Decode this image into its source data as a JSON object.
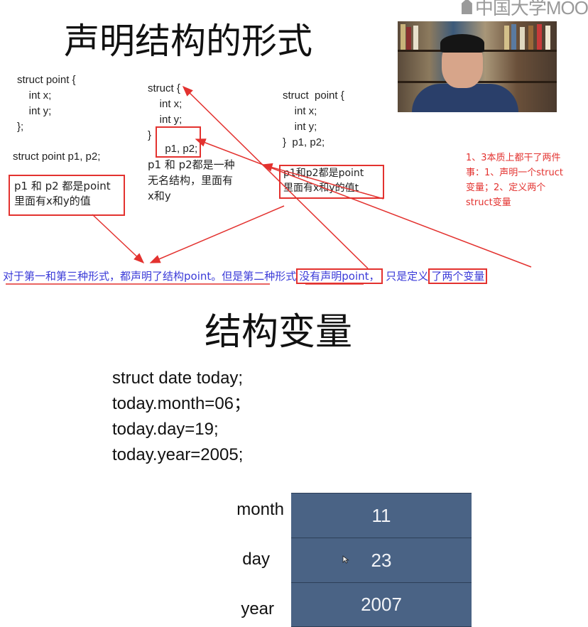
{
  "logo": {
    "text": "中国大学MOO"
  },
  "slide1": {
    "title": "声明结构的形式",
    "form1": {
      "code": "struct point {\n    int x;\n    int y;\n};",
      "decl": "struct point p1, p2;",
      "note": "p1 和 p2 都是point\n里面有x和y的值"
    },
    "form2": {
      "code": "struct {\n    int x;\n    int y;\n}",
      "vars": "p1, p2;",
      "note": "p1 和 p2都是一种\n无名结构，里面有\nx和y"
    },
    "form3": {
      "code": "struct  point {\n    int x;\n    int y;\n}  p1, p2;",
      "note": "p1和p2都是point\n里面有x和y的值t"
    },
    "red_note": "1、3本质上都干了两件\n事：1、声明一个struct\n变量；2、定义两个\nstruct变量",
    "blue_line": {
      "part1": "对于第一和第三种形式，都声明了结构point。但是第二种形式",
      "part2": "没有声明point，",
      "part3": " 只是定义",
      "part4": "了两个变量"
    }
  },
  "slide2": {
    "title": "结构变量",
    "code": "struct date today;\ntoday.month=06；\ntoday.day=19;\ntoday.year=2005;",
    "table": {
      "rows": [
        {
          "label": "month",
          "value": "11"
        },
        {
          "label": "day",
          "value": "23"
        },
        {
          "label": "year",
          "value": "2007"
        }
      ]
    }
  },
  "colors": {
    "annotation_red": "#e3322f",
    "annotation_blue": "#3a3ad8",
    "table_cell": "#4a6385"
  }
}
